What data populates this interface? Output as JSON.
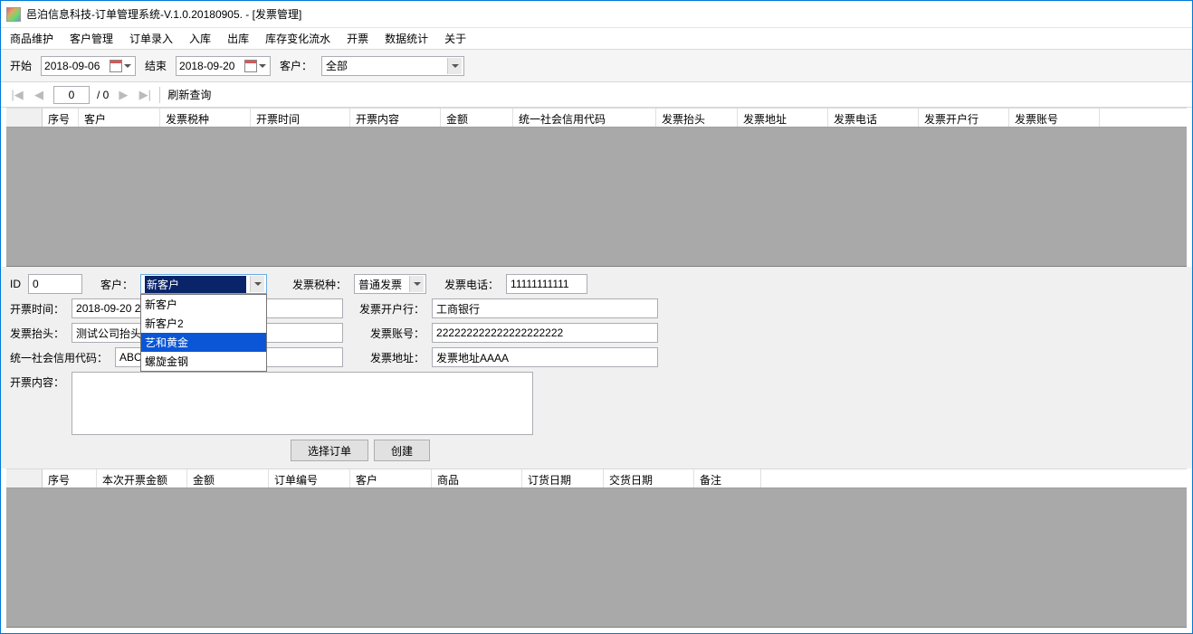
{
  "window": {
    "title": "邑泊信息科技-订单管理系统-V.1.0.20180905. - [发票管理]"
  },
  "menu": {
    "items": [
      "商品维护",
      "客户管理",
      "订单录入",
      "入库",
      "出库",
      "库存变化流水",
      "开票",
      "数据统计",
      "关于"
    ]
  },
  "filter": {
    "start_label": "开始",
    "start_value": "2018-09-06",
    "end_label": "结束",
    "end_value": "2018-09-20",
    "customer_label": "客户：",
    "customer_value": "全部"
  },
  "pager": {
    "current": "0",
    "total": "/ 0",
    "refresh_label": "刷新查询"
  },
  "grid1": {
    "columns": [
      "序号",
      "客户",
      "发票税种",
      "开票时间",
      "开票内容",
      "金额",
      "统一社会信用代码",
      "发票抬头",
      "发票地址",
      "发票电话",
      "发票开户行",
      "发票账号"
    ]
  },
  "form": {
    "id_label": "ID",
    "id_value": "0",
    "customer_label": "客户：",
    "customer_selected": "新客户",
    "customer_options": [
      "新客户",
      "新客户2",
      "艺和黄金",
      "螺旋金钢"
    ],
    "tax_label": "发票税种：",
    "tax_value": "普通发票",
    "phone_label": "发票电话：",
    "phone_value": "11111111111",
    "time_label": "开票时间：",
    "time_value": "2018-09-20 20:",
    "bank_label": "发票开户行：",
    "bank_value": "工商银行",
    "head_label": "发票抬头：",
    "head_value": "测试公司抬头",
    "acct_label": "发票账号：",
    "acct_value": "222222222222222222222",
    "code_label": "统一社会信用代码：",
    "code_value": "ABCDEF1234567890111",
    "addr_label": "发票地址：",
    "addr_value": "发票地址AAAA",
    "content_label": "开票内容：",
    "content_value": "",
    "btn_select": "选择订单",
    "btn_create": "创建"
  },
  "grid2": {
    "columns": [
      "序号",
      "本次开票金额",
      "金额",
      "订单编号",
      "客户",
      "商品",
      "订货日期",
      "交货日期",
      "备注"
    ]
  }
}
